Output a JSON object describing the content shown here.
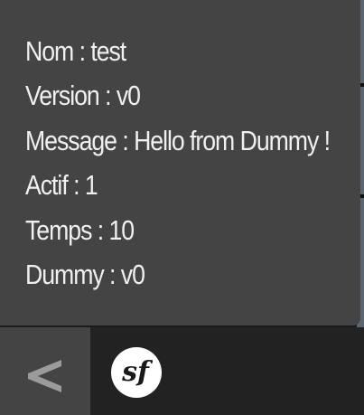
{
  "toolbar_info": {
    "rows": [
      "Nom : test",
      "Version : v0",
      "Message : Hello from Dummy !",
      "Actif : 1",
      "Temps : 10",
      "Dummy : v0"
    ]
  },
  "toolbar": {
    "toggle_icon": "chevron-left-icon",
    "logo_icon": "symfony-logo-icon"
  },
  "colors": {
    "panel_bg": "#444444",
    "toolbar_bg": "#222222",
    "text": "#f0f0f0",
    "chevron": "#9b9b9b",
    "logo_bg": "#ffffff",
    "logo_fg": "#1a1a1a"
  }
}
